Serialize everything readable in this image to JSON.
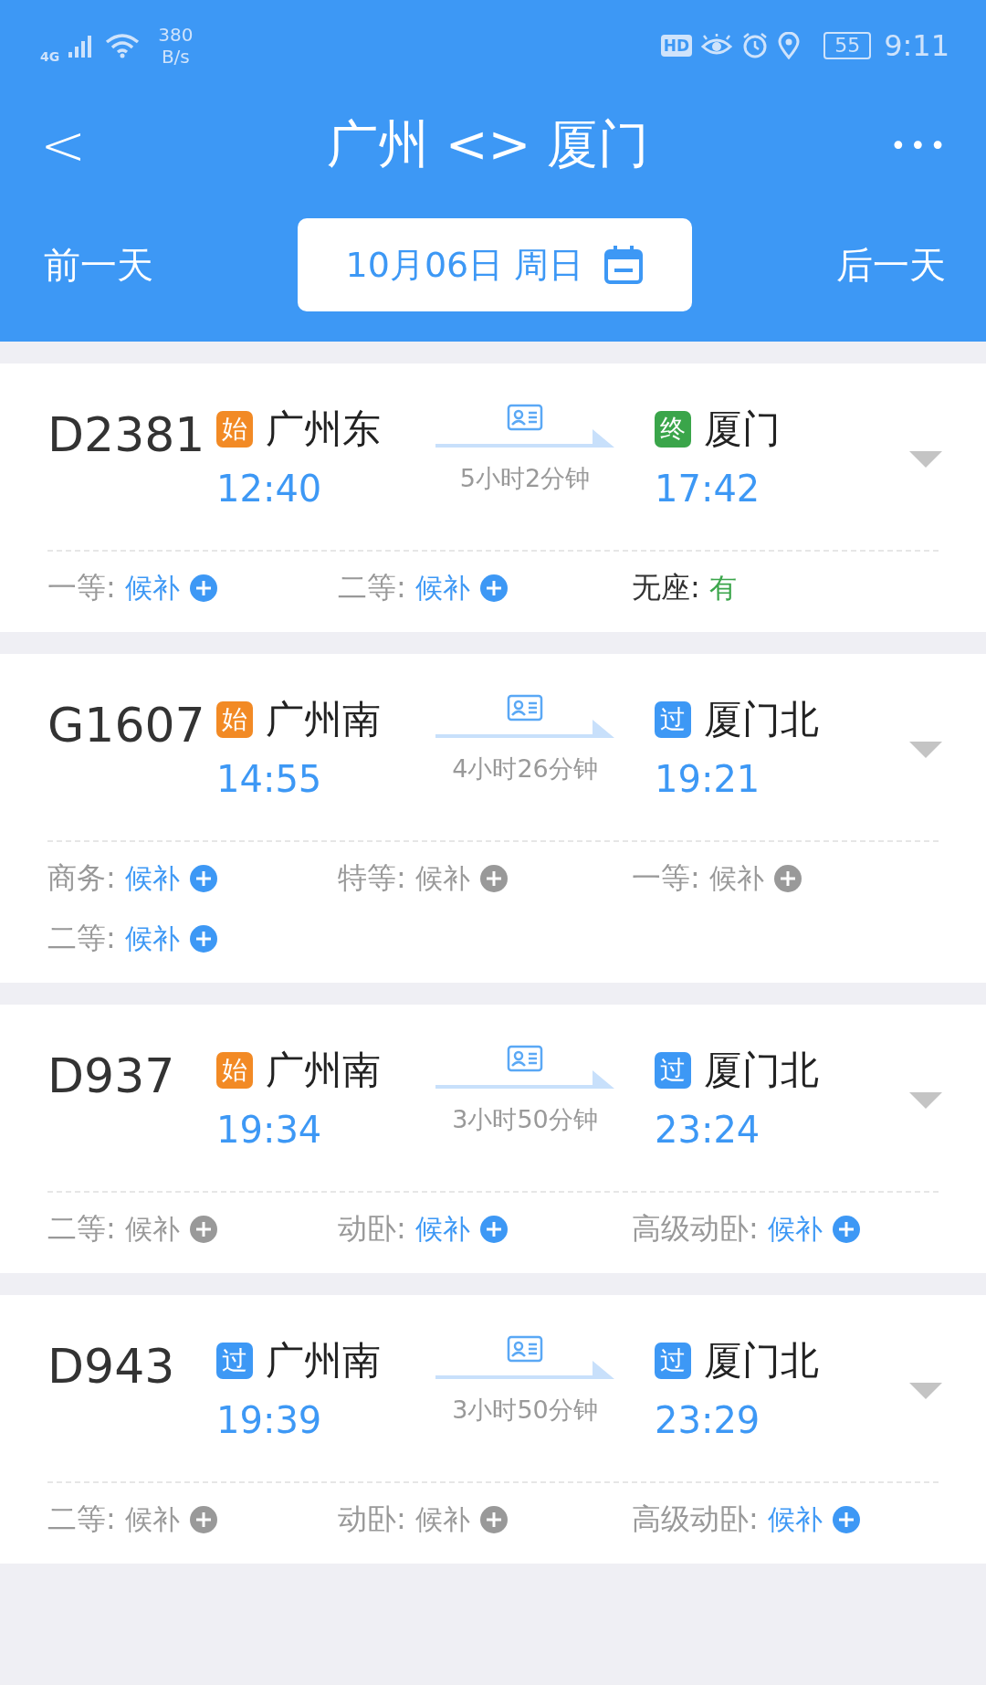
{
  "status_bar": {
    "network": "4G",
    "speed": "380",
    "speed_unit": "B/s",
    "hd": "HD",
    "battery": "55",
    "time": "9:11"
  },
  "header": {
    "back": "<",
    "title": "广州 <> 厦门",
    "more": "•••"
  },
  "date_bar": {
    "prev": "前一天",
    "date": "10月06日 周日",
    "next": "后一天"
  },
  "trains": [
    {
      "number": "D2381",
      "from": {
        "badge": "始",
        "color": "#f28a25",
        "station": "广州东",
        "time": "12:40"
      },
      "duration": "5小时2分钟",
      "to": {
        "badge": "终",
        "color": "#3aa54a",
        "station": "厦门",
        "time": "17:42"
      },
      "seats": [
        {
          "label": "一等:",
          "value": "候补",
          "kind": "waitlist",
          "available": true
        },
        {
          "label": "二等:",
          "value": "候补",
          "kind": "waitlist",
          "available": true
        },
        {
          "label": "无座:",
          "value": "有",
          "kind": "stock",
          "available": true
        }
      ]
    },
    {
      "number": "G1607",
      "from": {
        "badge": "始",
        "color": "#f28a25",
        "station": "广州南",
        "time": "14:55"
      },
      "duration": "4小时26分钟",
      "to": {
        "badge": "过",
        "color": "#3d98f5",
        "station": "厦门北",
        "time": "19:21"
      },
      "seats": [
        {
          "label": "商务:",
          "value": "候补",
          "kind": "waitlist",
          "available": true
        },
        {
          "label": "特等:",
          "value": "候补",
          "kind": "waitlist",
          "available": false
        },
        {
          "label": "一等:",
          "value": "候补",
          "kind": "waitlist",
          "available": false
        },
        {
          "label": "二等:",
          "value": "候补",
          "kind": "waitlist",
          "available": true
        }
      ]
    },
    {
      "number": "D937",
      "from": {
        "badge": "始",
        "color": "#f28a25",
        "station": "广州南",
        "time": "19:34"
      },
      "duration": "3小时50分钟",
      "to": {
        "badge": "过",
        "color": "#3d98f5",
        "station": "厦门北",
        "time": "23:24"
      },
      "seats": [
        {
          "label": "二等:",
          "value": "候补",
          "kind": "waitlist",
          "available": false
        },
        {
          "label": "动卧:",
          "value": "候补",
          "kind": "waitlist",
          "available": true
        },
        {
          "label": "高级动卧:",
          "value": "候补",
          "kind": "waitlist",
          "available": true
        }
      ]
    },
    {
      "number": "D943",
      "from": {
        "badge": "过",
        "color": "#3d98f5",
        "station": "广州南",
        "time": "19:39"
      },
      "duration": "3小时50分钟",
      "to": {
        "badge": "过",
        "color": "#3d98f5",
        "station": "厦门北",
        "time": "23:29"
      },
      "seats": [
        {
          "label": "二等:",
          "value": "候补",
          "kind": "waitlist",
          "available": false
        },
        {
          "label": "动卧:",
          "value": "候补",
          "kind": "waitlist",
          "available": false
        },
        {
          "label": "高级动卧:",
          "value": "候补",
          "kind": "waitlist",
          "available": true
        }
      ]
    }
  ]
}
